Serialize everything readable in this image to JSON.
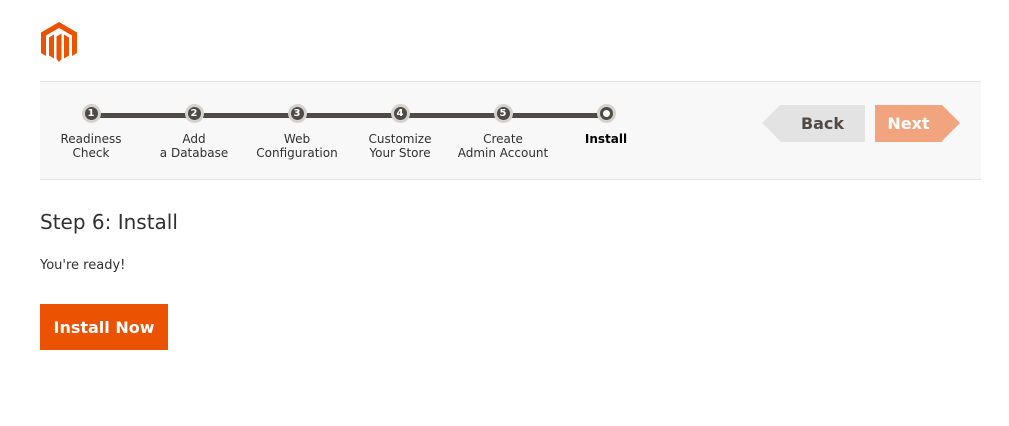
{
  "logo": {
    "icon": "magento-logo-icon",
    "color": "#eb5202"
  },
  "wizard": {
    "steps": [
      {
        "number": "1",
        "label": "Readiness\nCheck",
        "state": "complete"
      },
      {
        "number": "2",
        "label": "Add\na Database",
        "state": "complete"
      },
      {
        "number": "3",
        "label": "Web\nConfiguration",
        "state": "complete"
      },
      {
        "number": "4",
        "label": "Customize\nYour Store",
        "state": "complete"
      },
      {
        "number": "5",
        "label": "Create\nAdmin Account",
        "state": "complete"
      },
      {
        "number": "",
        "label": "Install",
        "state": "active"
      }
    ],
    "back_label": "Back",
    "next_label": "Next"
  },
  "main": {
    "title": "Step 6: Install",
    "message": "You're ready!",
    "install_label": "Install Now"
  },
  "colors": {
    "accent": "#eb5202",
    "next_disabled": "#f1a47e",
    "back": "#e3e3e3",
    "track": "#4e4a47"
  }
}
